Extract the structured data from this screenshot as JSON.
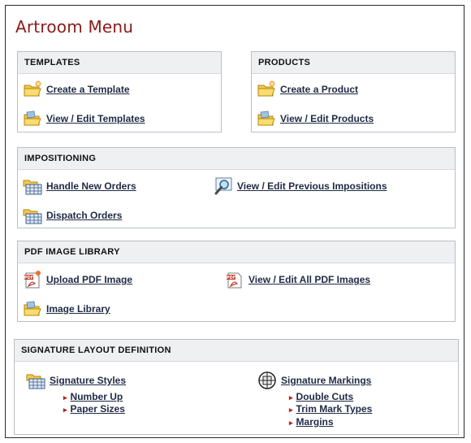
{
  "title": "Artroom Menu",
  "templates": {
    "header": "TEMPLATES",
    "create": "Create a Template",
    "view": "View / Edit Templates"
  },
  "products": {
    "header": "PRODUCTS",
    "create": "Create a Product",
    "view": "View / Edit Products"
  },
  "impositioning": {
    "header": "IMPOSITIONING",
    "handle_new": "Handle New Orders",
    "view_previous": "View / Edit Previous Impositions",
    "dispatch": "Dispatch Orders"
  },
  "pdf_library": {
    "header": "PDF IMAGE LIBRARY",
    "upload": "Upload PDF Image",
    "view_all": "View / Edit All PDF Images",
    "image_library": "Image Library"
  },
  "signature": {
    "header": "SIGNATURE LAYOUT DEFINITION",
    "styles": "Signature Styles",
    "styles_sub": [
      "Number Up",
      "Paper Sizes"
    ],
    "markings": "Signature Markings",
    "markings_sub": [
      "Double Cuts",
      "Trim Mark Types",
      "Margins"
    ]
  },
  "icons": {
    "folder_new": "folder-new-icon",
    "folder_open": "folder-open-icon",
    "folder_grid": "folder-grid-icon",
    "magnifier": "magnifier-icon",
    "pdf_new": "pdf-new-icon",
    "pdf": "pdf-icon",
    "signature_markings": "signature-markings-icon"
  }
}
